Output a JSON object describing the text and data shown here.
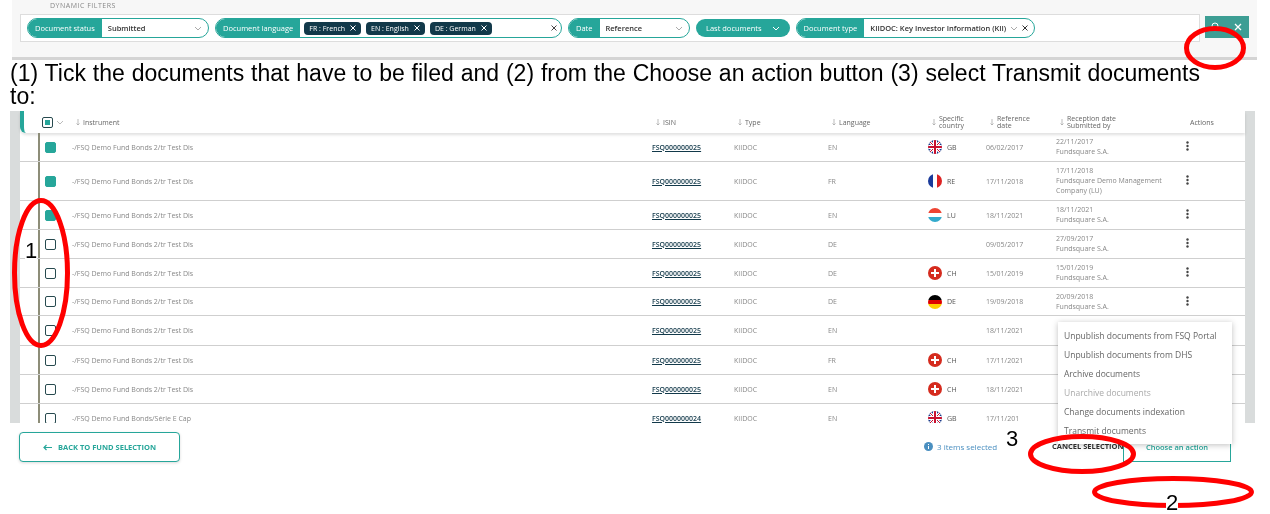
{
  "filters_panel": {
    "heading": "DYNAMIC FILTERS",
    "filters": [
      {
        "kind": "select",
        "label": "Document status",
        "value": "Submitted"
      },
      {
        "kind": "tags",
        "label": "Document language",
        "tags": [
          "FR : French",
          "EN : English",
          "DE : German"
        ]
      },
      {
        "kind": "select",
        "label": "Date",
        "value": "Reference"
      },
      {
        "kind": "dropdown",
        "label": "Last documents"
      },
      {
        "kind": "select_clear",
        "label": "Document type",
        "value": "KIIDOC: Key Investor Information (KII)"
      }
    ]
  },
  "instruction": "(1) Tick the documents that have to be filed and (2) from the Choose an action button (3) select Transmit documents to:",
  "table": {
    "header_checkbox": {
      "indeterminate": true
    },
    "columns": [
      "Instrument",
      "ISIN",
      "Type",
      "Language",
      "Specific country",
      "Reference date",
      "Reception date Submitted by",
      "Actions"
    ],
    "rows": [
      {
        "checked": true,
        "instrument": "-/FSQ Demo Fund Bonds 2/tr Test Dis",
        "isin": "FSQ000000025",
        "type": "KIIDOC",
        "language": "EN",
        "flag": {
          "kind": "gb"
        },
        "country": "GB",
        "reference_date": "06/02/2017",
        "reception_date": "22/11/2017",
        "submitted_by": "Fundsquare S.A."
      },
      {
        "checked": true,
        "instrument": "-/FSQ Demo Fund Bonds 2/tr Test Dis",
        "isin": "FSQ000000025",
        "type": "KIIDOC",
        "language": "FR",
        "flag": {
          "kind": "fr"
        },
        "country": "RE",
        "reference_date": "17/11/2018",
        "reception_date": "17/11/2018",
        "submitted_by": "Fundsquare Demo Management Company (LU)"
      },
      {
        "checked": true,
        "instrument": "-/FSQ Demo Fund Bonds 2/tr Test Dis",
        "isin": "FSQ000000025",
        "type": "KIIDOC",
        "language": "EN",
        "flag": {
          "kind": "lu"
        },
        "country": "LU",
        "reference_date": "18/11/2021",
        "reception_date": "18/11/2021",
        "submitted_by": "Fundsquare S.A."
      },
      {
        "checked": false,
        "instrument": "-/FSQ Demo Fund Bonds 2/tr Test Dis",
        "isin": "FSQ000000025",
        "type": "KIIDOC",
        "language": "DE",
        "reference_date": "09/05/2017",
        "reception_date": "27/09/2017",
        "submitted_by": "Fundsquare S.A."
      },
      {
        "checked": false,
        "instrument": "-/FSQ Demo Fund Bonds 2/tr Test Dis",
        "isin": "FSQ000000025",
        "type": "KIIDOC",
        "language": "DE",
        "flag": {
          "kind": "ch"
        },
        "country": "CH",
        "reference_date": "15/01/2019",
        "reception_date": "15/01/2019",
        "submitted_by": "Fundsquare S.A."
      },
      {
        "checked": false,
        "instrument": "-/FSQ Demo Fund Bonds 2/tr Test Dis",
        "isin": "FSQ000000025",
        "type": "KIIDOC",
        "language": "DE",
        "flag": {
          "kind": "de"
        },
        "country": "DE",
        "reference_date": "19/09/2018",
        "reception_date": "20/09/2018",
        "submitted_by": "Fundsquare S.A."
      },
      {
        "checked": false,
        "instrument": "-/FSQ Demo Fund Bonds 2/tr Test Dis",
        "isin": "FSQ000000025",
        "type": "KIIDOC",
        "language": "EN",
        "reference_date": "18/11/2021"
      },
      {
        "checked": false,
        "instrument": "-/FSQ Demo Fund Bonds 2/tr Test Dis",
        "isin": "FSQ000000025",
        "type": "KIIDOC",
        "language": "FR",
        "flag": {
          "kind": "ch"
        },
        "country": "CH",
        "reference_date": "17/11/2021"
      },
      {
        "checked": false,
        "instrument": "-/FSQ Demo Fund Bonds 2/tr Test Dis",
        "isin": "FSQ000000025",
        "type": "KIIDOC",
        "language": "EN",
        "flag": {
          "kind": "ch"
        },
        "country": "CH",
        "reference_date": "18/11/2021"
      },
      {
        "checked": false,
        "instrument": "-/FSQ Demo Fund Bonds/Série E Cap",
        "isin": "FSQ000000024",
        "type": "KIIDOC",
        "language": "EN",
        "flag": {
          "kind": "gb"
        },
        "country": "GB",
        "reference_date": "17/11/201"
      }
    ]
  },
  "action_menu": [
    {
      "label": "Unpublish documents from FSQ Portal",
      "disabled": false
    },
    {
      "label": "Unpublish documents from DHS",
      "disabled": false
    },
    {
      "label": "Archive documents",
      "disabled": false
    },
    {
      "label": "Unarchive documents",
      "disabled": true
    },
    {
      "label": "Change documents indexation",
      "disabled": false
    },
    {
      "label": "Transmit documents",
      "disabled": false
    }
  ],
  "footer": {
    "back_button": "BACK TO FUND SELECTION",
    "selection_info": "3 items selected",
    "cancel_button": "CANCEL SELECTION",
    "action_button": "Choose an action"
  },
  "annotations": [
    {
      "kind": "ellipse",
      "number": "1"
    },
    {
      "kind": "ellipse"
    },
    {
      "kind": "ellipse",
      "number": "3"
    },
    {
      "kind": "ellipse",
      "number": "2"
    }
  ]
}
